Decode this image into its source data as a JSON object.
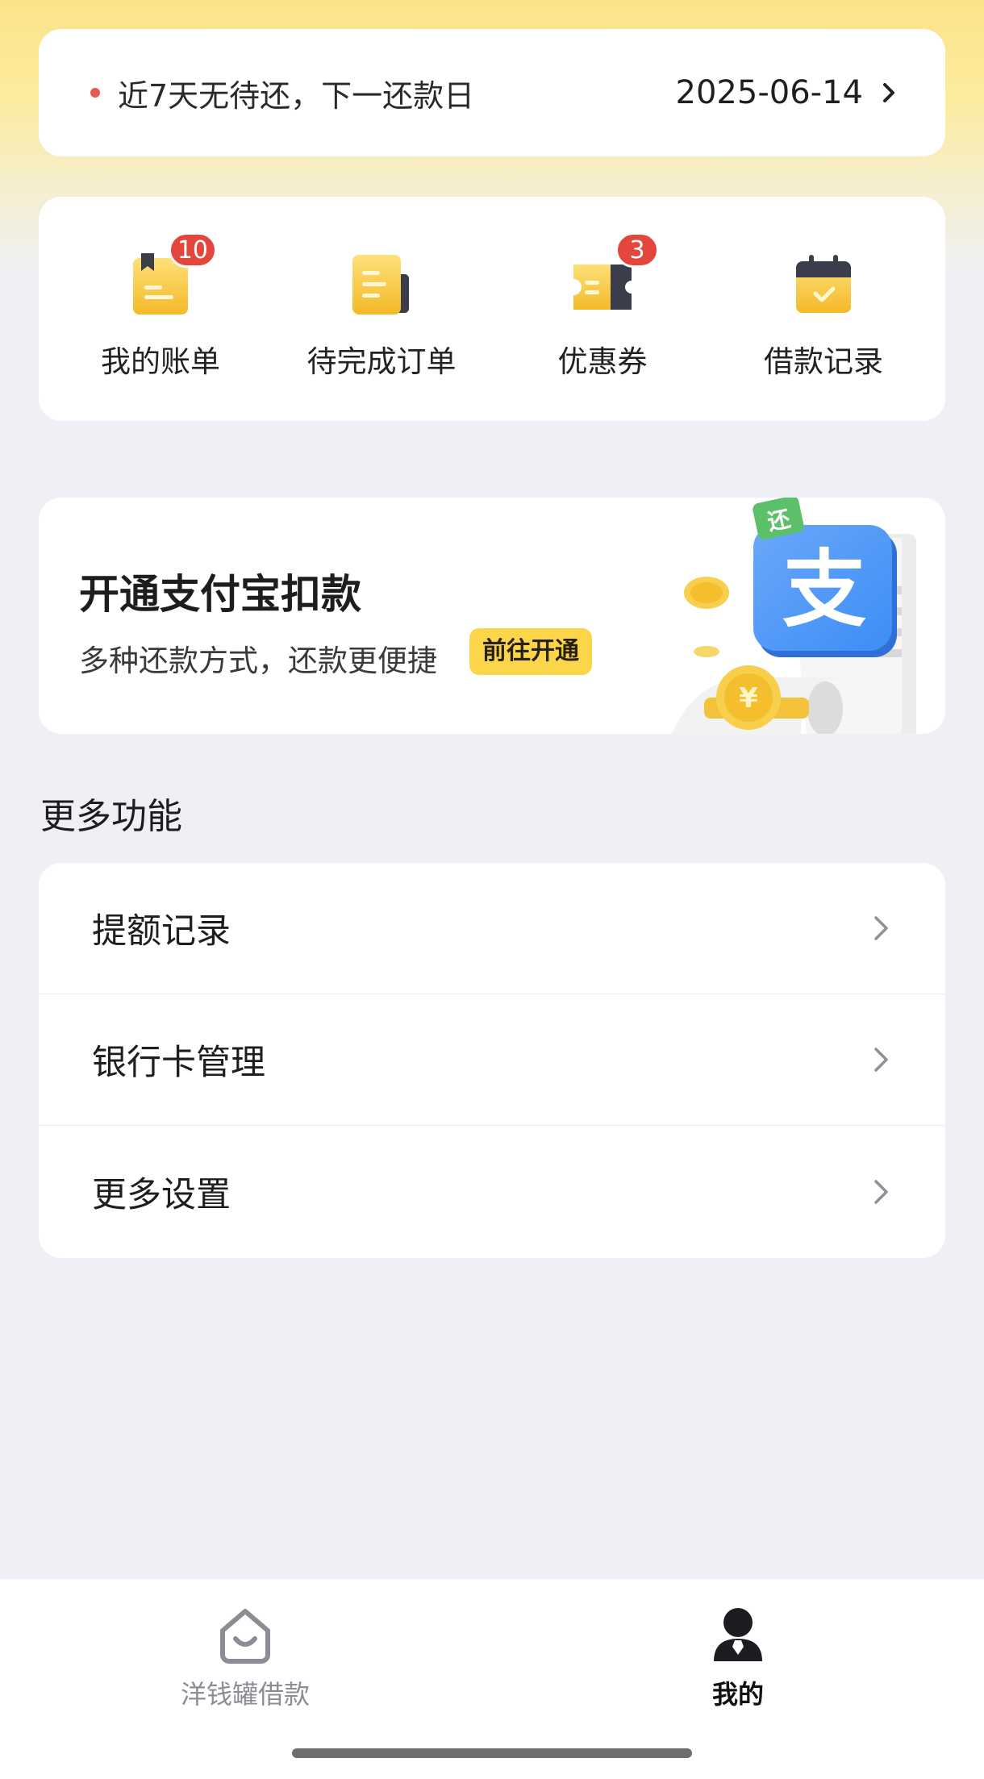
{
  "notice": {
    "text": "近7天无待还，下一还款日",
    "date": "2025-06-14"
  },
  "shortcuts": [
    {
      "label": "我的账单",
      "badge": "10",
      "icon": "bill-icon"
    },
    {
      "label": "待完成订单",
      "badge": "",
      "icon": "order-icon"
    },
    {
      "label": "优惠券",
      "badge": "3",
      "icon": "coupon-icon"
    },
    {
      "label": "借款记录",
      "badge": "",
      "icon": "calendar-icon"
    }
  ],
  "banner": {
    "title": "开通支付宝扣款",
    "subtitle": "多种还款方式，还款更便捷",
    "button": "前往开通",
    "art_glyph": "支",
    "tag_glyph": "还",
    "coin_glyph": "¥"
  },
  "more": {
    "title": "更多功能",
    "items": [
      {
        "label": "提额记录"
      },
      {
        "label": "银行卡管理"
      },
      {
        "label": "更多设置"
      }
    ]
  },
  "tabbar": {
    "home": "洋钱罐借款",
    "mine": "我的"
  },
  "colors": {
    "accent_yellow": "#fbd64a",
    "badge_red": "#e2463c",
    "alipay_blue": "#3d8df5"
  }
}
